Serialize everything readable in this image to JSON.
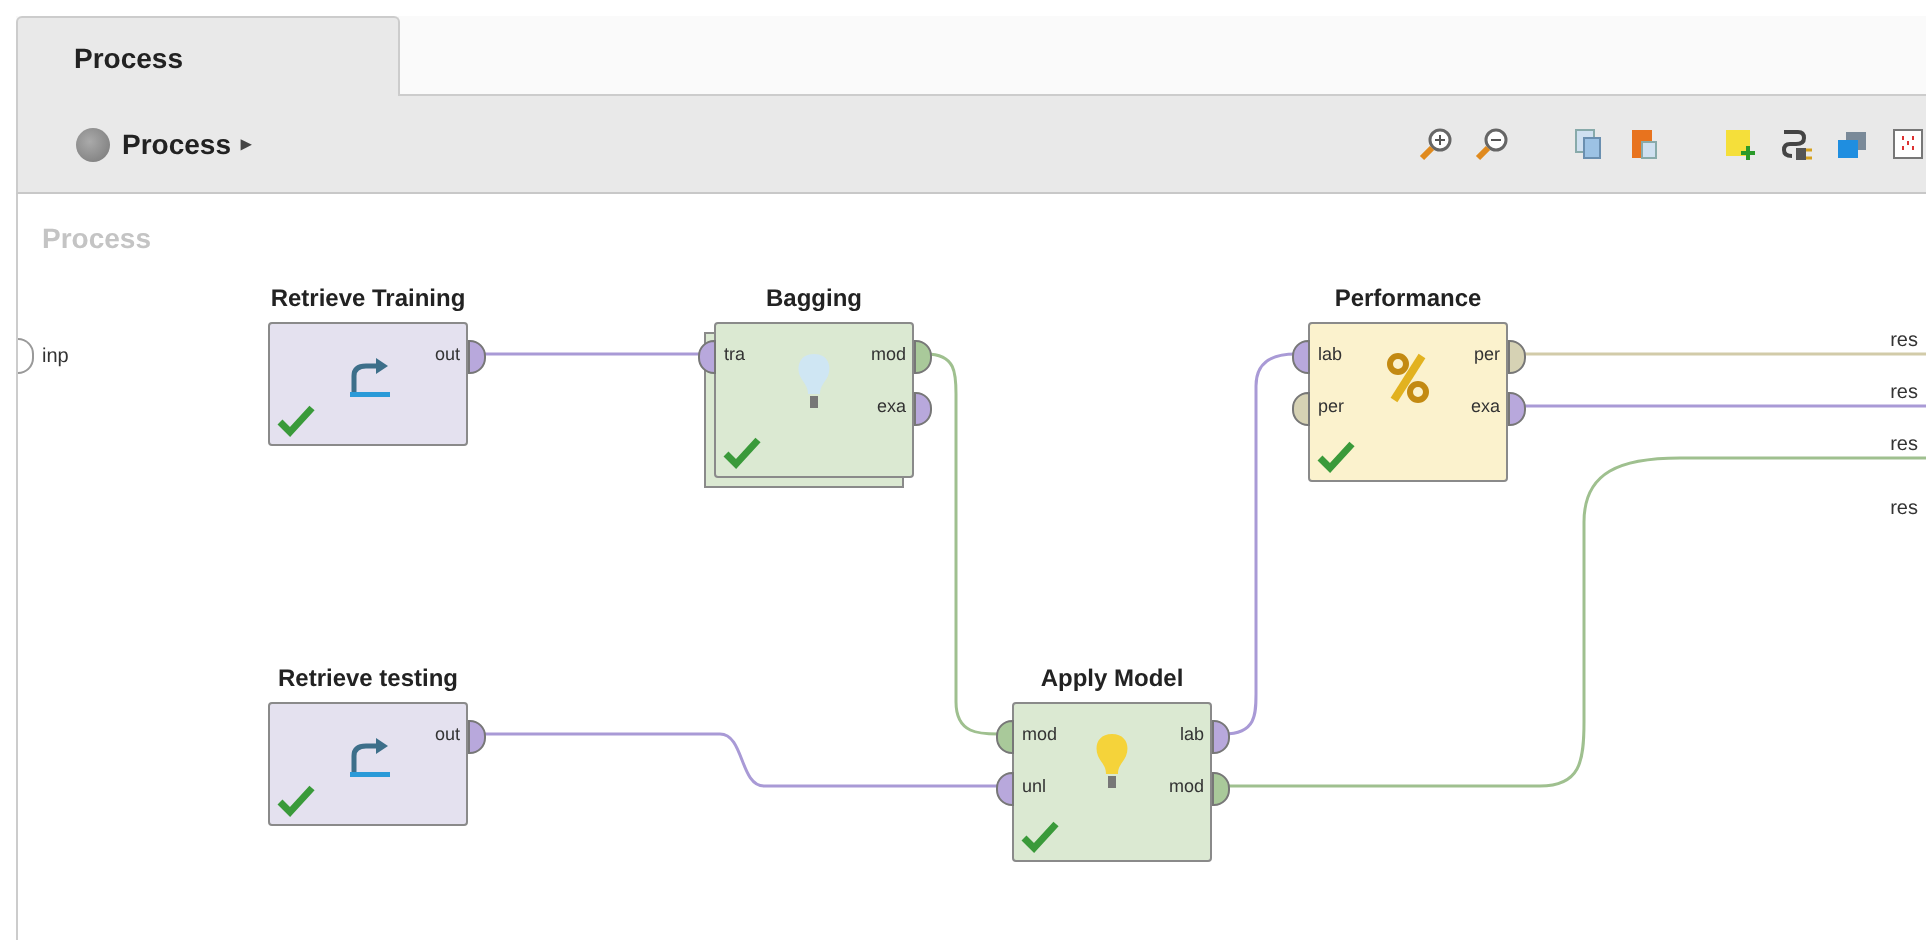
{
  "tabs": [
    {
      "label": "Process",
      "selected": true
    }
  ],
  "breadcrumb": {
    "label": "Process",
    "arrow": "▸"
  },
  "canvas": {
    "title": "Process",
    "input_port": "inp",
    "result_ports": [
      {
        "label": "res"
      },
      {
        "label": "res"
      },
      {
        "label": "res"
      },
      {
        "label": "res"
      }
    ],
    "operators": [
      {
        "name": "Retrieve Training",
        "kind": "retrieve",
        "nested": false,
        "ok": true,
        "outputs": [
          {
            "label": "out",
            "kind": "data"
          }
        ]
      },
      {
        "name": "Bagging",
        "kind": "learner",
        "nested": true,
        "ok": true,
        "inputs": [
          {
            "label": "tra",
            "kind": "data"
          }
        ],
        "outputs": [
          {
            "label": "mod",
            "kind": "model"
          },
          {
            "label": "exa",
            "kind": "data"
          }
        ]
      },
      {
        "name": "Performance",
        "kind": "evaluation",
        "nested": false,
        "ok": true,
        "inputs": [
          {
            "label": "lab",
            "kind": "data"
          },
          {
            "label": "per",
            "kind": "performance"
          }
        ],
        "outputs": [
          {
            "label": "per",
            "kind": "performance"
          },
          {
            "label": "exa",
            "kind": "data"
          }
        ]
      },
      {
        "name": "Retrieve testing",
        "kind": "retrieve",
        "nested": false,
        "ok": true,
        "outputs": [
          {
            "label": "out",
            "kind": "data"
          }
        ]
      },
      {
        "name": "Apply Model",
        "kind": "apply",
        "nested": false,
        "ok": true,
        "inputs": [
          {
            "label": "mod",
            "kind": "model"
          },
          {
            "label": "unl",
            "kind": "data"
          }
        ],
        "outputs": [
          {
            "label": "lab",
            "kind": "data"
          },
          {
            "label": "mod",
            "kind": "model"
          }
        ]
      }
    ]
  }
}
